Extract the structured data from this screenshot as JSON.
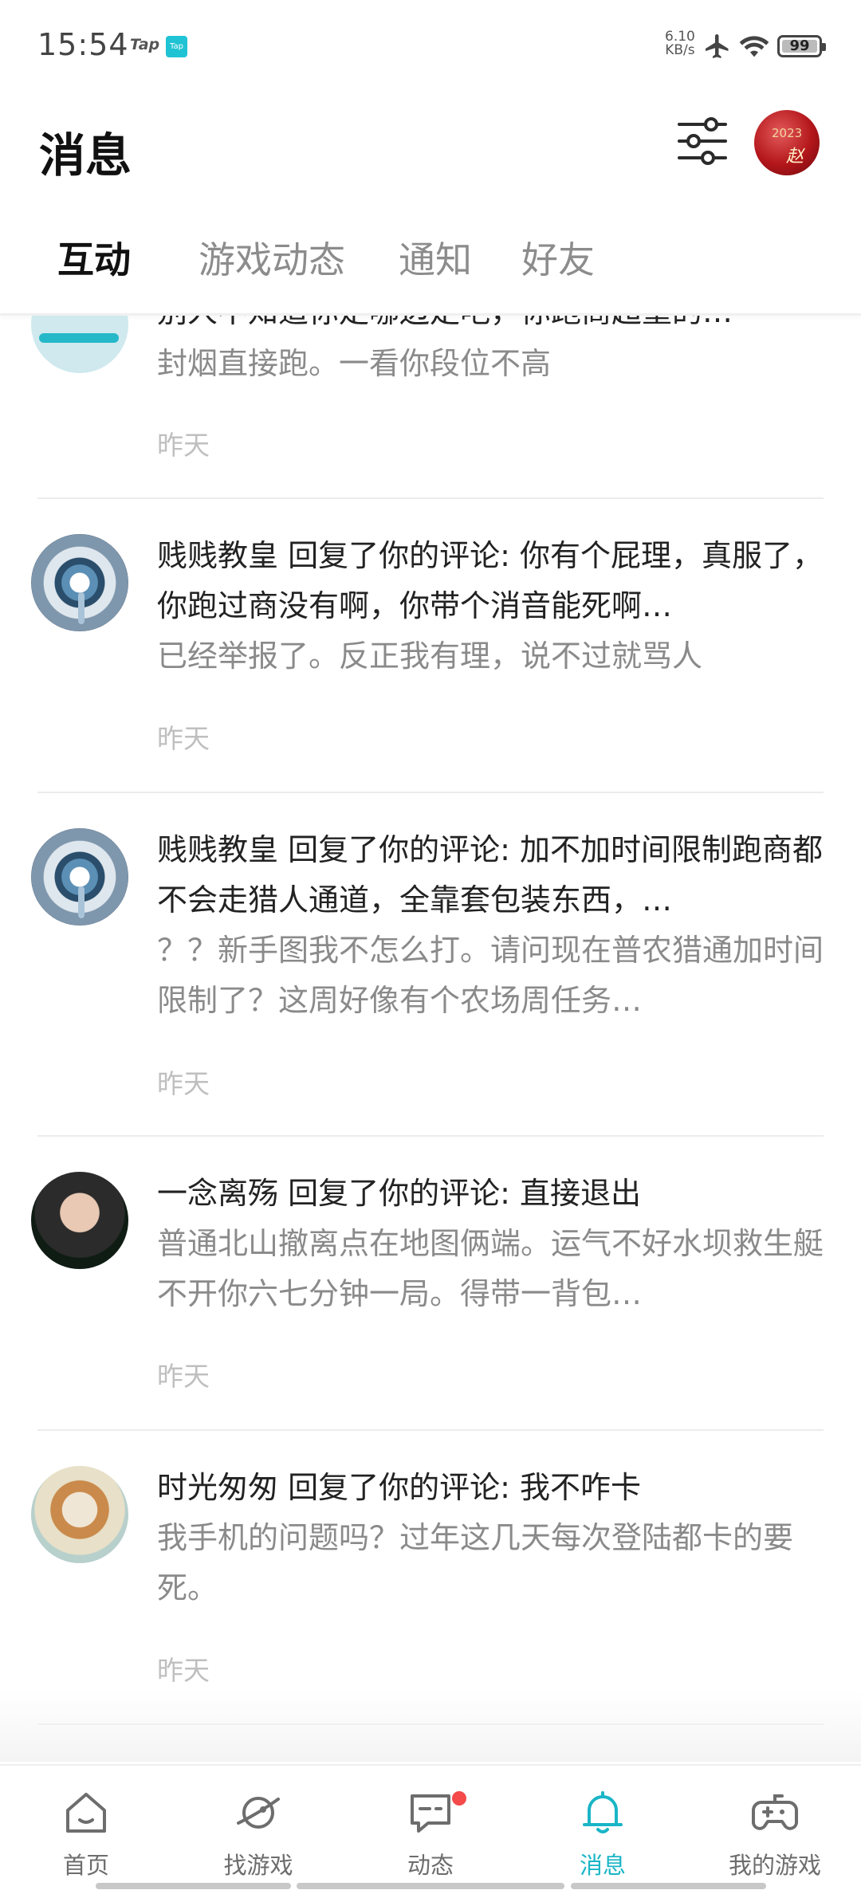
{
  "status_bar": {
    "time": "15:54",
    "app_badge_1": "Tap",
    "app_badge_2": "Tap",
    "net_speed_value": "6.10",
    "net_speed_unit": "KB/s",
    "battery": "99"
  },
  "header": {
    "title": "消息",
    "avatar_text_1": "2023",
    "avatar_text_2": "赵"
  },
  "tabs": [
    {
      "label": "互动",
      "active": true
    },
    {
      "label": "游戏动态",
      "active": false
    },
    {
      "label": "通知",
      "active": false
    },
    {
      "label": "好友",
      "active": false
    }
  ],
  "messages": [
    {
      "head": "别人不知道你走哪边走吧，你跑商超重的…",
      "quote": "封烟直接跑。一看你段位不高",
      "time": "昨天"
    },
    {
      "head": "贱贱教皇 回复了你的评论: 你有个屁理，真服了，你跑过商没有啊，你带个消音能死啊…",
      "quote": "已经举报了。反正我有理，说不过就骂人",
      "time": "昨天"
    },
    {
      "head": "贱贱教皇 回复了你的评论: 加不加时间限制跑商都不会走猎人通道，全靠套包装东西，…",
      "quote": "？？新手图我不怎么打。请问现在普农猎通加时间限制了？这周好像有个农场周任务…",
      "time": "昨天"
    },
    {
      "head": "一念离殇 回复了你的评论: 直接退出",
      "quote": "普通北山撤离点在地图俩端。运气不好水坝救生艇不开你六七分钟一局。得带一背包…",
      "time": "昨天"
    },
    {
      "head": "时光匆匆 回复了你的评论: 我不咋卡",
      "quote": "我手机的问题吗？过年这几天每次登陆都卡的要死。",
      "time": "昨天"
    }
  ],
  "bottom_nav": [
    {
      "label": "首页",
      "icon": "home-icon",
      "active": false
    },
    {
      "label": "找游戏",
      "icon": "planet-icon",
      "active": false
    },
    {
      "label": "动态",
      "icon": "chat-icon",
      "active": false,
      "badge": true
    },
    {
      "label": "消息",
      "icon": "bell-icon",
      "active": true
    },
    {
      "label": "我的游戏",
      "icon": "gamepad-icon",
      "active": false
    }
  ],
  "colors": {
    "accent": "#19b5c6",
    "badge": "#f44a4a",
    "primary_text": "#222222",
    "secondary_text": "#8a8a8a",
    "time_text": "#bfbfbf"
  }
}
